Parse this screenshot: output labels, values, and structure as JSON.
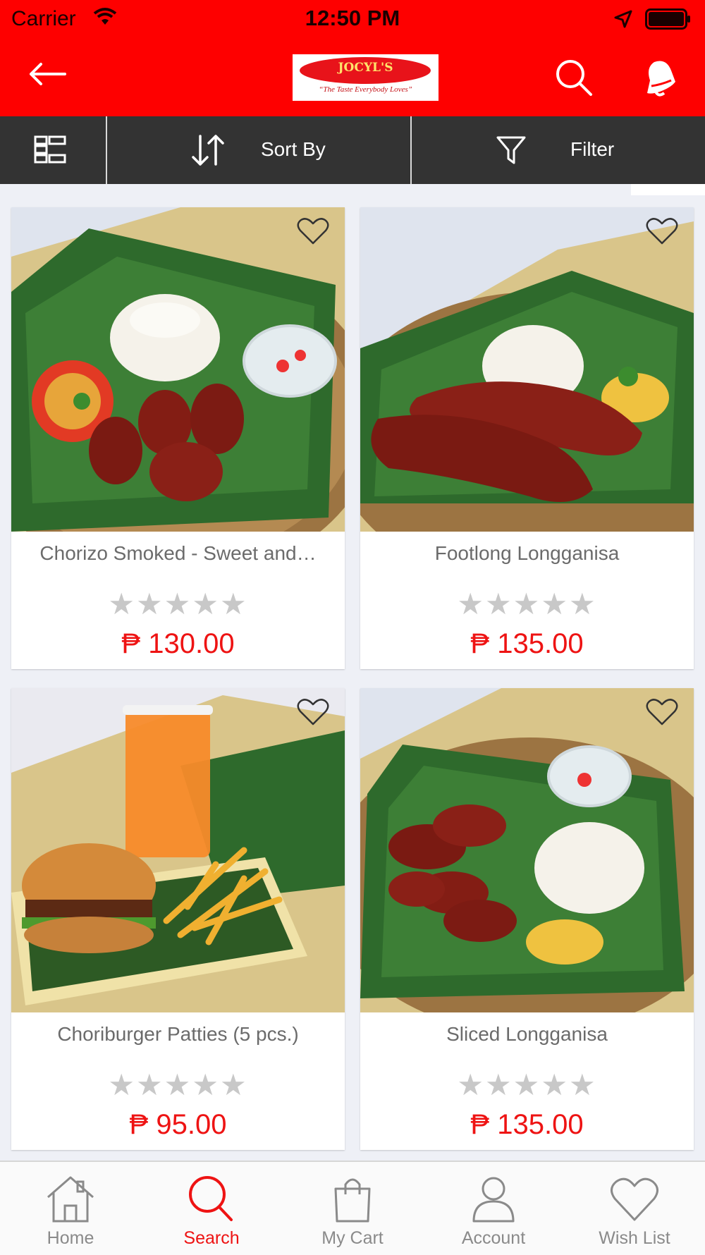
{
  "status_bar": {
    "carrier": "Carrier",
    "time": "12:50 PM"
  },
  "header": {
    "logo_text": "JOCYL'S",
    "logo_tagline": "“The Taste Everybody Loves”"
  },
  "toolbar": {
    "sort_label": "Sort By",
    "filter_label": "Filter"
  },
  "products": [
    {
      "name": "Chorizo Smoked - Sweet and…",
      "rating": 0,
      "max_rating": 5,
      "stars": "★★★★★",
      "price": "₱ 130.00"
    },
    {
      "name": "Footlong Longganisa",
      "rating": 0,
      "max_rating": 5,
      "stars": "★★★★★",
      "price": "₱ 135.00"
    },
    {
      "name": "Choriburger Patties (5 pcs.)",
      "rating": 0,
      "max_rating": 5,
      "stars": "★★★★★",
      "price": "₱ 95.00"
    },
    {
      "name": "Sliced Longganisa",
      "rating": 0,
      "max_rating": 5,
      "stars": "★★★★★",
      "price": "₱ 135.00"
    }
  ],
  "bottom_nav": {
    "items": [
      {
        "label": "Home",
        "icon": "home-icon",
        "active": false
      },
      {
        "label": "Search",
        "icon": "search-icon",
        "active": true
      },
      {
        "label": "My Cart",
        "icon": "shopping-bag-icon",
        "active": false
      },
      {
        "label": "Account",
        "icon": "user-icon",
        "active": false
      },
      {
        "label": "Wish List",
        "icon": "heart-icon",
        "active": false
      }
    ]
  },
  "colors": {
    "brand_red": "#fe0000",
    "price_red": "#ee1313",
    "toolbar": "#333333",
    "star_inactive": "#c8c8c8"
  }
}
